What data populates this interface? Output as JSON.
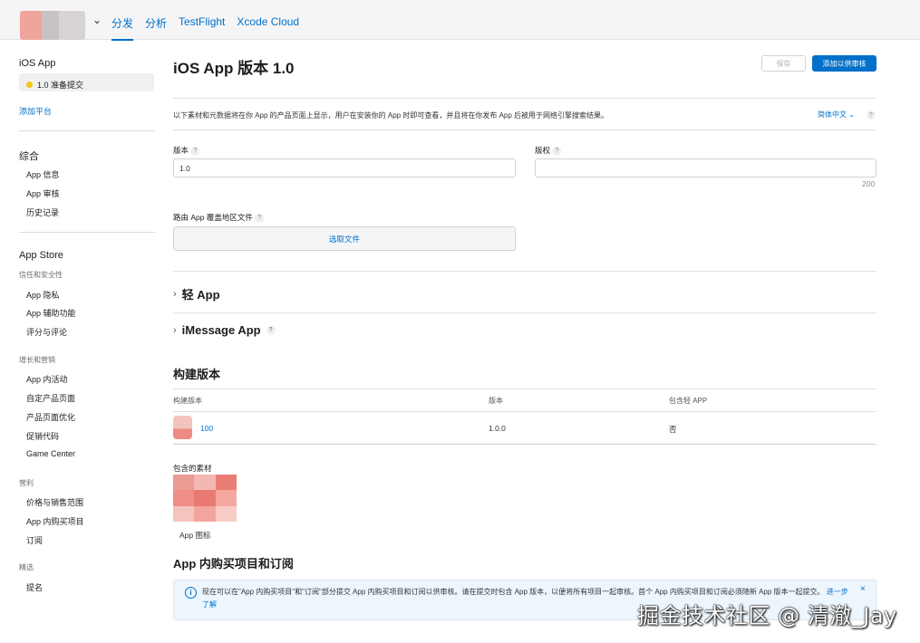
{
  "topbar": {
    "nav": [
      "分发",
      "分析",
      "TestFlight",
      "Xcode Cloud"
    ]
  },
  "sidebar": {
    "app_title": "iOS App",
    "version_status": "1.0 准备提交",
    "add_platform": "添加平台",
    "section_general": "综合",
    "general_items": [
      "App 信息",
      "App 审核",
      "历史记录"
    ],
    "section_store": "App Store",
    "sub_trust": "信任和安全性",
    "trust_items": [
      "App 隐私",
      "App 辅助功能",
      "评分与评论"
    ],
    "sub_growth": "增长和营销",
    "growth_items": [
      "App 内活动",
      "自定产品页面",
      "产品页面优化",
      "促销代码",
      "Game Center"
    ],
    "sub_revenue": "营利",
    "revenue_items": [
      "价格与销售范围",
      "App 内购买项目",
      "订阅"
    ],
    "sub_featured": "精选",
    "featured_items": [
      "提名"
    ]
  },
  "main": {
    "title": "iOS App 版本 1.0",
    "save_label": "保存",
    "submit_label": "添加以供审核",
    "description": "以下素材和元数据将在你 App 的产品页面上显示，用户在安装你的 App 时即可查看，并且将在你发布 App 后被用于网络引擎搜索结果。",
    "language": "简体中文 ⌄",
    "version_label": "版本",
    "version_value": "1.0",
    "copyright_label": "版权",
    "copyright_value": "",
    "copyright_counter": "200",
    "routing_label": "路由 App 覆盖地区文件",
    "choose_file": "选取文件",
    "clip_label": "轻 App",
    "imessage_label": "iMessage App",
    "build_title": "构建版本",
    "build_headers": [
      "构建版本",
      "版本",
      "包含轻 APP"
    ],
    "build_row": {
      "build": "100",
      "version": "1.0.0",
      "clip": "否"
    },
    "assets_label": "包含的素材",
    "icon_caption": "App 图标",
    "iap_title": "App 内购买项目和订阅",
    "notice_text": "现在可以在\"App 内购买项目\"和\"订阅\"部分提交 App 内购买项目和订阅以供审核。请在提交时包含 App 版本，以便将所有项目一起审核。首个 App 内购买项目和订阅必须随新 App 版本一起提交。",
    "notice_link": "进一步了解",
    "help_glyph": "?",
    "info_glyph": "i",
    "close_glyph": "×"
  },
  "watermark": "掘金技术社区 @ 清澈_Jay"
}
